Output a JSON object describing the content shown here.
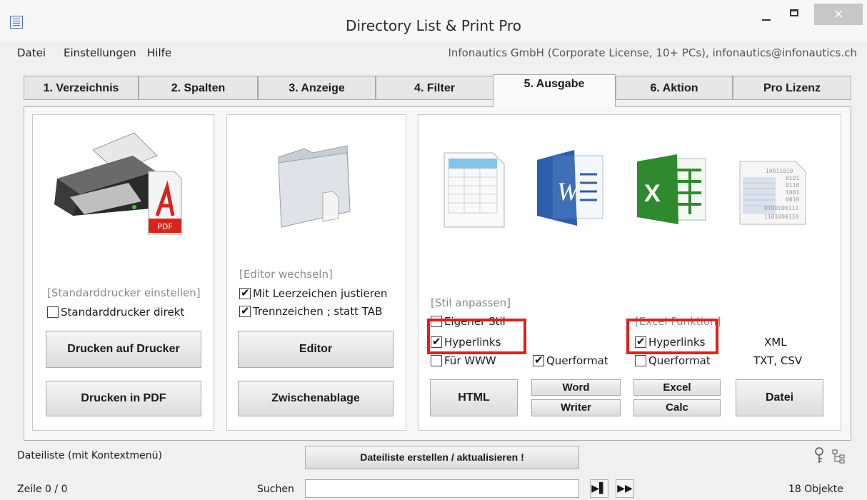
{
  "window": {
    "title": "Directory List & Print Pro",
    "close_glyph": "×"
  },
  "menu": {
    "items": [
      "Datei",
      "Einstellungen",
      "Hilfe"
    ],
    "license": "Infonautics GmbH (Corporate License, 10+ PCs), infonautics@infonautics.ch"
  },
  "tabs": [
    {
      "label": "1. Verzeichnis"
    },
    {
      "label": "2. Spalten"
    },
    {
      "label": "3. Anzeige"
    },
    {
      "label": "4. Filter"
    },
    {
      "label": "5. Ausgabe",
      "active": true
    },
    {
      "label": "6. Aktion"
    },
    {
      "label": "Pro Lizenz"
    }
  ],
  "printer": {
    "link": "[Standarddrucker einstellen]",
    "checkbox": {
      "label": "Standarddrucker direkt",
      "checked": false
    },
    "btn_print": "Drucken auf Drucker",
    "btn_pdf": "Drucken in PDF",
    "pdf_badge": "PDF"
  },
  "editor": {
    "link": "[Editor wechseln]",
    "cb_space": {
      "label": "Mit Leerzeichen justieren",
      "checked": true
    },
    "cb_sep": {
      "label": "Trennzeichen ; statt TAB",
      "checked": true
    },
    "btn_editor": "Editor",
    "btn_clip": "Zwischenablage"
  },
  "export": {
    "style_link": "[Stil anpassen]",
    "cb_own_style": {
      "label": "Eigener Stil",
      "checked": false
    },
    "cb_hyperlinks_html": {
      "label": "Hyperlinks",
      "checked": true
    },
    "cb_www": {
      "label": "Für WWW",
      "checked": false
    },
    "cb_landscape_word": {
      "label": "Querformat",
      "checked": true
    },
    "excel_link": "[Excel Funktion]",
    "cb_hyperlinks_excel": {
      "label": "Hyperlinks",
      "checked": true
    },
    "cb_landscape_excel": {
      "label": "Querformat",
      "checked": false
    },
    "lbl_xml": "XML",
    "lbl_txt": "TXT, CSV",
    "btn_html": "HTML",
    "btn_word": "Word",
    "btn_writer": "Writer",
    "btn_excel": "Excel",
    "btn_calc": "Calc",
    "btn_datei": "Datei",
    "word_letter": "W",
    "excel_letter": "X",
    "data_lines": [
      "10011010",
      "0101",
      "0110",
      "1001",
      "0010",
      "0100100111",
      "1101000110"
    ]
  },
  "status": {
    "filelist_label": "Dateiliste (mit Kontextmenü)",
    "btn_create": "Dateiliste erstellen / aktualisieren !",
    "line": "Zeile 0 / 0",
    "search_label": "Suchen",
    "search_value": "",
    "count": "18 Objekte",
    "next_glyph": "▶▌",
    "last_glyph": "▶▶"
  },
  "colors": {
    "highlight": "#e0201e",
    "word": "#2b5fae",
    "excel": "#2f8a2f",
    "pdf": "#d9241c"
  }
}
